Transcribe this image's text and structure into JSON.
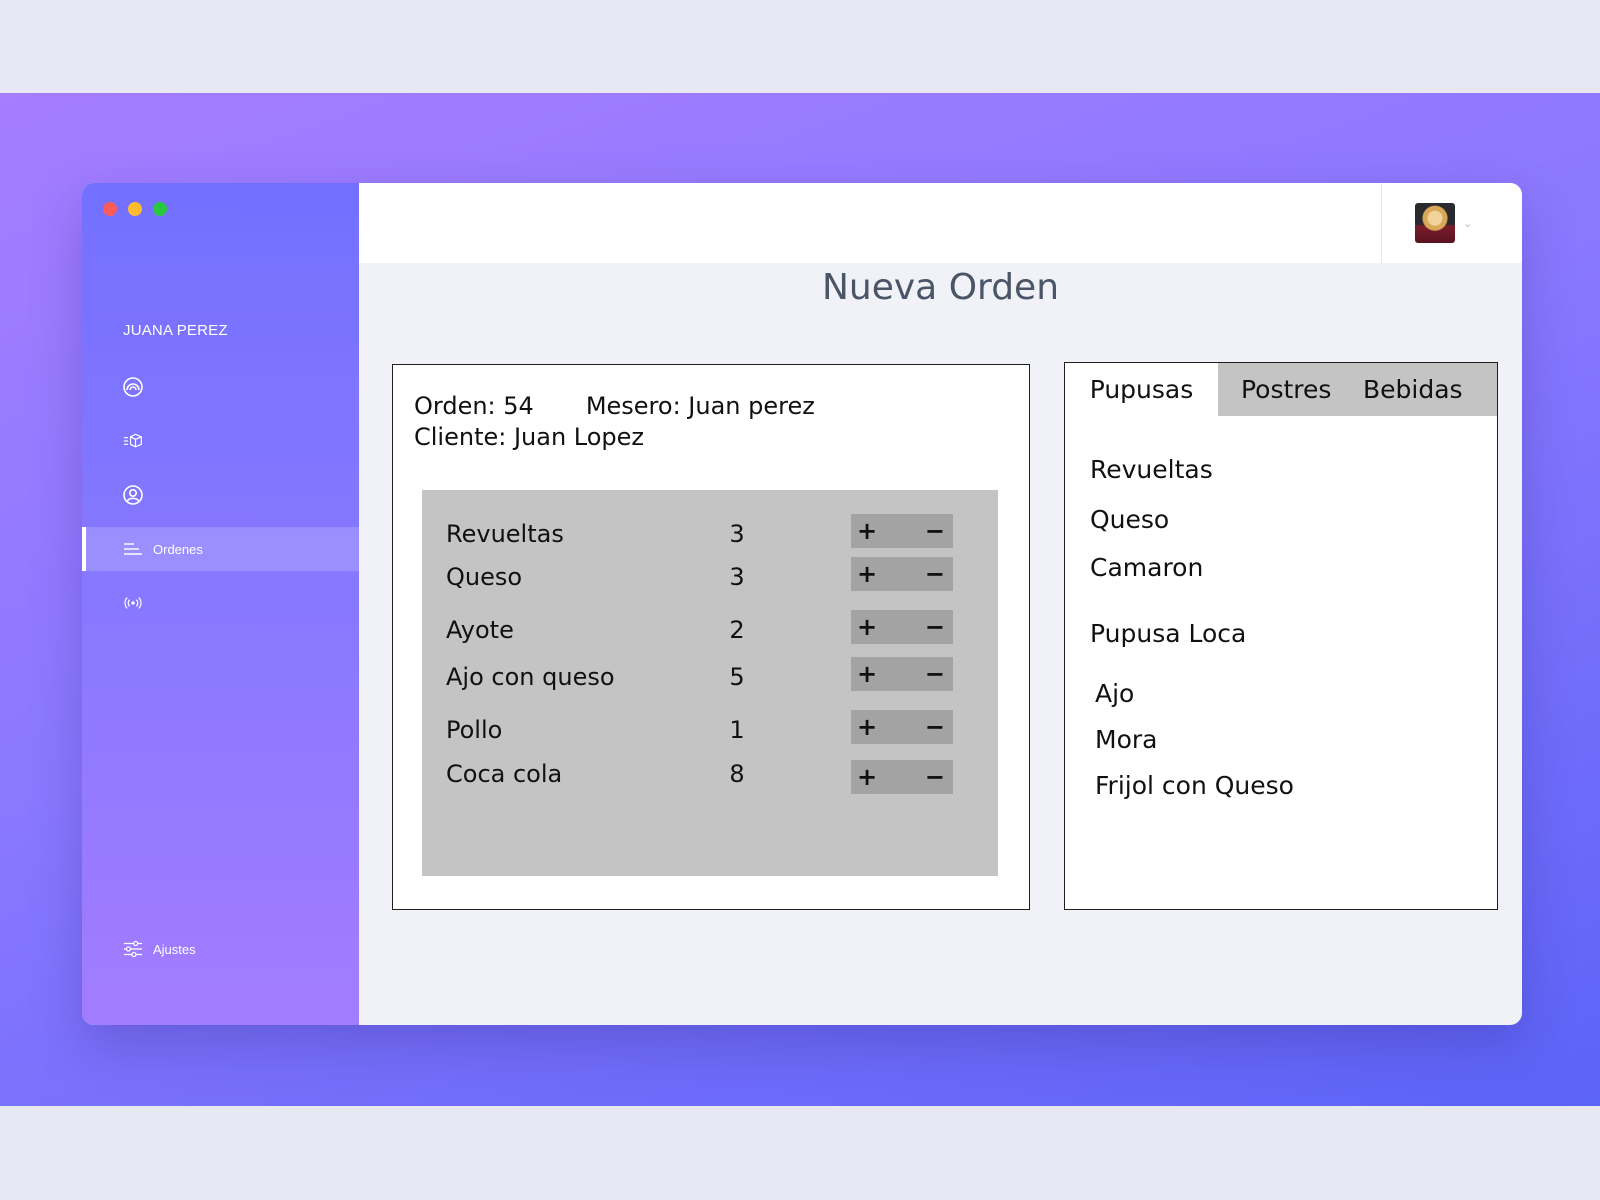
{
  "window": {
    "traffic_lights": [
      "close",
      "minimize",
      "zoom"
    ]
  },
  "sidebar": {
    "user_name": "JUANA PEREZ",
    "items": [
      {
        "icon": "dashboard-icon",
        "label": ""
      },
      {
        "icon": "products-icon",
        "label": ""
      },
      {
        "icon": "user-icon",
        "label": ""
      },
      {
        "icon": "orders-icon",
        "label": "Ordenes",
        "active": true
      },
      {
        "icon": "broadcast-icon",
        "label": ""
      }
    ],
    "settings": {
      "icon": "sliders-icon",
      "label": "Ajustes"
    }
  },
  "header": {
    "avatar": "avatar",
    "dropdown_icon": "chevron-down-icon"
  },
  "page": {
    "title": "Nueva Orden"
  },
  "order": {
    "number_text": "Orden: 54",
    "waiter_text": "Mesero: Juan perez",
    "client_text": "Cliente: Juan Lopez",
    "items": [
      {
        "name": "Revueltas",
        "qty": "3"
      },
      {
        "name": "Queso",
        "qty": "3"
      },
      {
        "name": "Ayote",
        "qty": "2"
      },
      {
        "name": "Ajo con queso",
        "qty": "5"
      },
      {
        "name": "Pollo",
        "qty": "1"
      },
      {
        "name": "Coca cola",
        "qty": "8"
      }
    ],
    "plus_label": "+",
    "minus_label": "−"
  },
  "menu": {
    "tabs": [
      "Pupusas",
      "Postres",
      "Bebidas"
    ],
    "active_tab": "Pupusas",
    "items": [
      "Revueltas",
      "Queso",
      "Camaron",
      "Pupusa Loca",
      "Ajo",
      "Mora",
      "Frijol con Queso"
    ]
  },
  "colors": {
    "accent": "#7370ff",
    "panel_gray": "#c4c4c4",
    "stepper_gray": "#a3a3a3"
  }
}
